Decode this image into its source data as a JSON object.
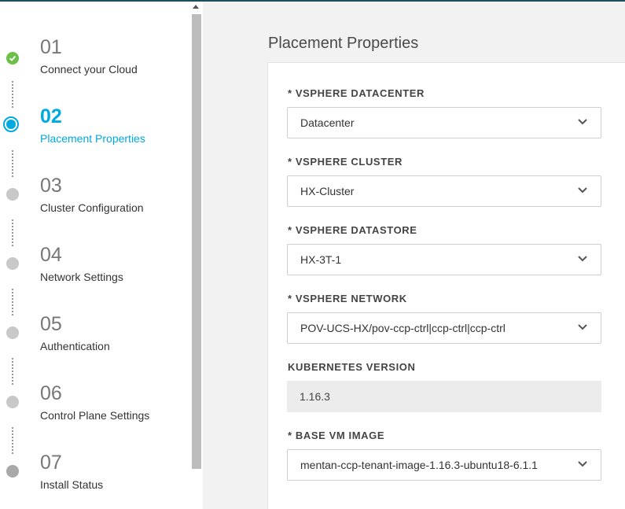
{
  "sidebar": {
    "steps": [
      {
        "number": "01",
        "label": "Connect your Cloud",
        "status": "complete"
      },
      {
        "number": "02",
        "label": "Placement Properties",
        "status": "current"
      },
      {
        "number": "03",
        "label": "Cluster Configuration",
        "status": "pending"
      },
      {
        "number": "04",
        "label": "Network Settings",
        "status": "pending"
      },
      {
        "number": "05",
        "label": "Authentication",
        "status": "pending"
      },
      {
        "number": "06",
        "label": "Control Plane Settings",
        "status": "pending"
      },
      {
        "number": "07",
        "label": "Install Status",
        "status": "pending"
      }
    ]
  },
  "main": {
    "title": "Placement Properties",
    "fields": {
      "datacenter": {
        "label": "* VSPHERE DATACENTER",
        "value": "Datacenter"
      },
      "cluster": {
        "label": "* VSPHERE CLUSTER",
        "value": "HX-Cluster"
      },
      "datastore": {
        "label": "* VSPHERE DATASTORE",
        "value": "HX-3T-1"
      },
      "network": {
        "label": "* VSPHERE NETWORK",
        "value": "POV-UCS-HX/pov-ccp-ctrl|ccp-ctrl|ccp-ctrl"
      },
      "k8s_version": {
        "label": "KUBERNETES VERSION",
        "value": "1.16.3"
      },
      "base_image": {
        "label": "* BASE VM IMAGE",
        "value": "mentan-ccp-tenant-image-1.16.3-ubuntu18-6.1.1"
      }
    }
  },
  "colors": {
    "accent": "#00a9e0",
    "complete": "#6cc04a",
    "pending": "#c8c8c8"
  },
  "icons": {
    "complete": "check-icon",
    "dropdown": "chevron-down-icon"
  }
}
